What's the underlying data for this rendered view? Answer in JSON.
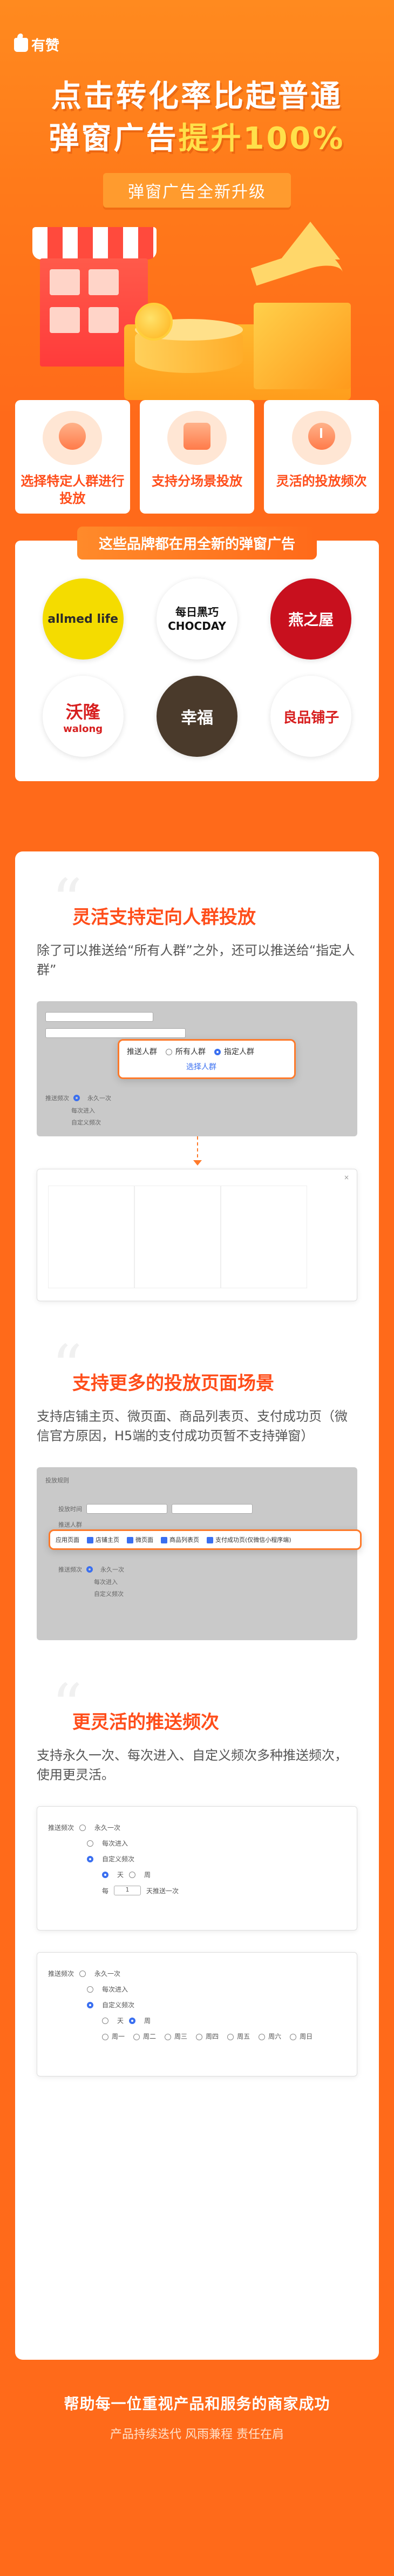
{
  "brand": {
    "name": "有赞"
  },
  "hero": {
    "title_line1": "点击转化率比起普通",
    "title_line2_pre": "弹窗广告",
    "title_line2_hl": "提升100%",
    "subtitle": "弹窗广告全新升级"
  },
  "features": [
    {
      "label": "选择特定人群进行投放",
      "icon": "user-icon"
    },
    {
      "label": "支持分场景投放",
      "icon": "cart-icon"
    },
    {
      "label": "灵活的投放频次",
      "icon": "clock-icon"
    }
  ],
  "brands": {
    "title": "这些品牌都在用全新的弹窗广告",
    "items": [
      {
        "line1": "allmed life",
        "line2": ""
      },
      {
        "line1": "每日黑巧",
        "line2": "CHOCDAY"
      },
      {
        "line1": "燕之屋",
        "line2": ""
      },
      {
        "line1": "沃隆",
        "line2": "walong"
      },
      {
        "line1": "幸福",
        "line2": ""
      },
      {
        "line1": "良品铺子",
        "line2": ""
      }
    ]
  },
  "sections": [
    {
      "title": "灵活支持定向人群投放",
      "desc": "除了可以推送给“所有人群”之外，还可以推送给“指定人群”",
      "mock": {
        "send_label": "推送人群",
        "opt_all": "所有人群",
        "opt_specific": "指定人群",
        "select_link": "选择人群",
        "freq_label": "推送频次",
        "freq_opts": [
          "永久一次",
          "每次进入",
          "自定义频次"
        ]
      }
    },
    {
      "title": "支持更多的投放页面场景",
      "desc": "支持店铺主页、微页面、商品列表页、支付成功页（微信官方原因，H5端的支付成功页暂不支持弹窗）",
      "mock": {
        "header": "投放规则",
        "date_label": "投放时间",
        "people_label": "推送人群",
        "page_label": "应用页面",
        "pages": [
          "店铺主页",
          "微页面",
          "商品列表页",
          "支付成功页(仅微信小程序端)"
        ],
        "freq_label": "推送频次",
        "freq_opts": [
          "永久一次",
          "每次进入",
          "自定义频次"
        ]
      }
    },
    {
      "title": "更灵活的推送频次",
      "desc": "支持永久一次、每次进入、自定义频次多种推送频次，使用更灵活。",
      "mock": {
        "freq_label": "推送频次",
        "freq_opts": [
          "永久一次",
          "每次进入",
          "自定义频次"
        ],
        "unit_day": "天",
        "unit_week": "周",
        "every": "每",
        "num": "1",
        "tail": "天推送一次",
        "weekdays": [
          "周一",
          "周二",
          "周三",
          "周四",
          "周五",
          "周六",
          "周日"
        ]
      }
    }
  ],
  "footer": {
    "line1": "帮助每一位重视产品和服务的商家成功",
    "line2": "产品持续迭代  风雨兼程  责任在肩"
  },
  "colors": {
    "accent": "#ff4d1a",
    "bg": "#ff6a1a",
    "link": "#3a6ff0"
  }
}
